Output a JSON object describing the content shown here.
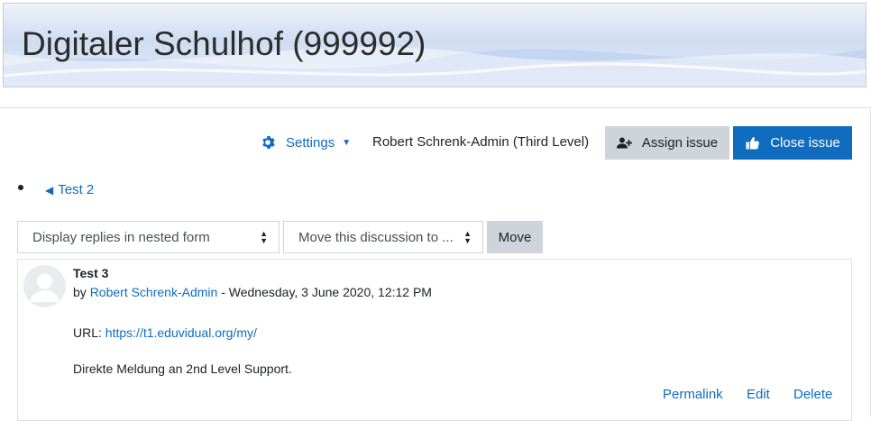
{
  "header": {
    "course_title": "Digitaler Schulhof (999992)"
  },
  "toolbar": {
    "settings_label": "Settings",
    "settings_icon": "gear-icon",
    "assigned_user": "Robert Schrenk-Admin (Third Level)",
    "assign_button_label": "Assign issue",
    "assign_button_icon": "user-plus-icon",
    "close_button_label": "Close issue",
    "close_button_icon": "thumbs-up-icon"
  },
  "navigation": {
    "prev_discussion_label": "Test 2"
  },
  "controls": {
    "display_mode_selected": "Display replies in nested form",
    "move_discussion_selected": "Move this discussion to ...",
    "move_button_label": "Move"
  },
  "post": {
    "subject": "Test 3",
    "by_prefix": "by",
    "author": "Robert Schrenk-Admin",
    "date_separator": " - ",
    "date": "Wednesday, 3 June 2020, 12:12 PM",
    "url_label": "URL:",
    "url": "https://t1.eduvidual.org/my/",
    "message": "Direkte Meldung an 2nd Level Support.",
    "actions": {
      "permalink": "Permalink",
      "edit": "Edit",
      "delete": "Delete"
    }
  },
  "colors": {
    "link_blue": "#0f6cbf",
    "secondary_button": "#ced4da",
    "primary_button": "#0f6cbf"
  }
}
